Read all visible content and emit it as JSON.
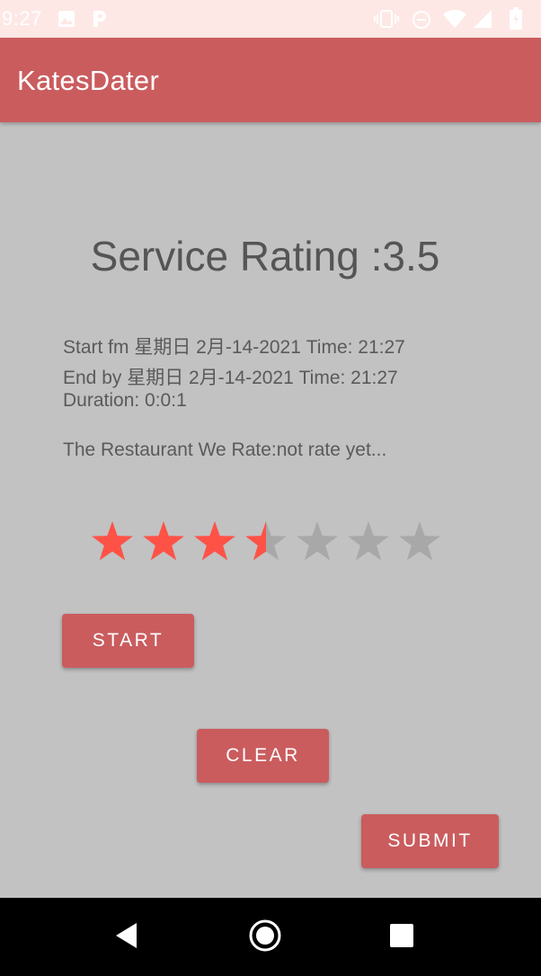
{
  "status_bar": {
    "time": "9:27",
    "icons": [
      "image-icon",
      "parking-icon",
      "vibrate-icon",
      "do-not-disturb-icon",
      "wifi-icon",
      "signal-icon",
      "battery-icon"
    ]
  },
  "app_bar": {
    "title": "KatesDater"
  },
  "main": {
    "rating_title": "Service Rating :3.5",
    "start_line": "Start fm 星期日 2月-14-2021 Time: 21:27",
    "end_line": "End by  星期日 2月-14-2021 Time: 21:27",
    "duration_line": "Duration:  0:0:1",
    "restaurant_line": "The Restaurant We Rate:not rate yet..."
  },
  "rating_bar": {
    "rating": 3.5,
    "max": 7,
    "filled_color": "#ff5247",
    "empty_color": "#a8a8a8"
  },
  "buttons": {
    "start_label": "START",
    "clear_label": "CLEAR",
    "submit_label": "SUBMIT"
  },
  "colors": {
    "primary": "#ca5c5e",
    "status_bar": "#fde8e6",
    "background": "#c2c2c2"
  }
}
